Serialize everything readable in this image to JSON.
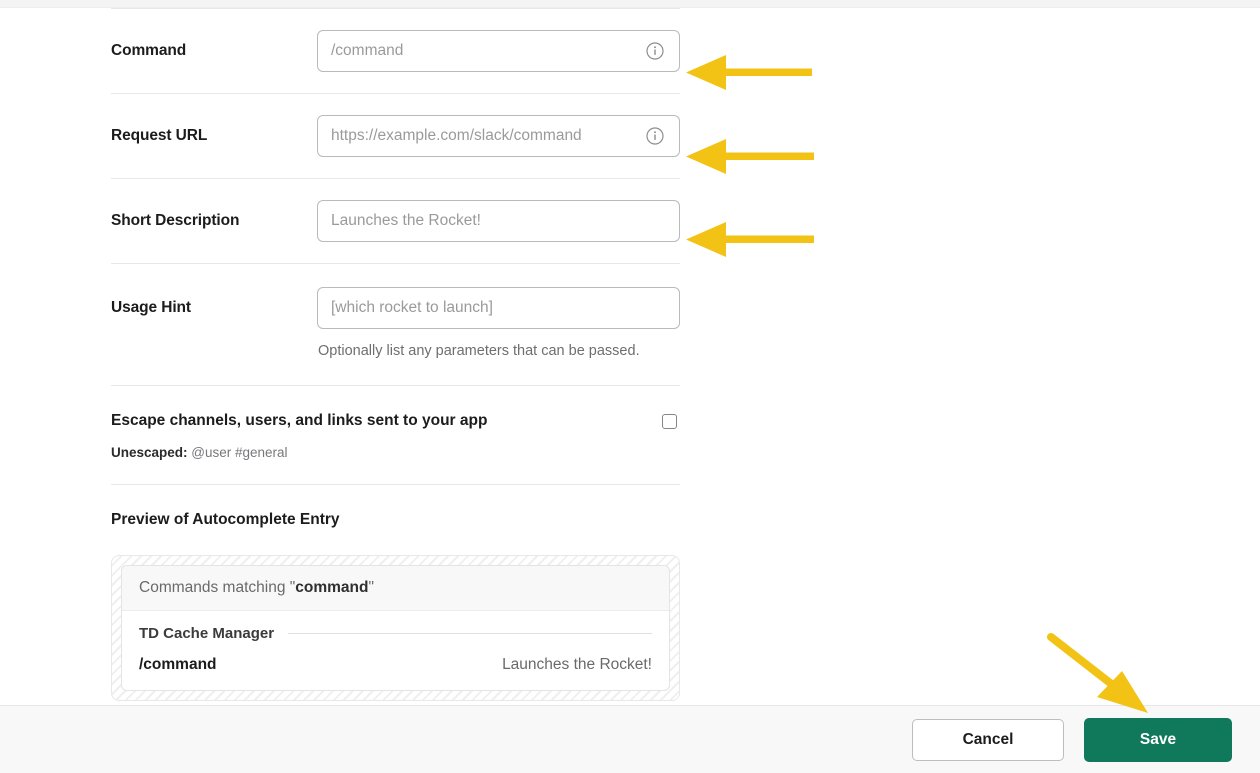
{
  "form": {
    "fields": [
      {
        "label": "Command",
        "placeholder": "/command",
        "value": "",
        "has_info_icon": true
      },
      {
        "label": "Request URL",
        "placeholder": "https://example.com/slack/command",
        "value": "",
        "has_info_icon": true
      },
      {
        "label": "Short Description",
        "placeholder": "Launches the Rocket!",
        "value": "",
        "has_info_icon": false
      },
      {
        "label": "Usage Hint",
        "placeholder": "[which rocket to launch]",
        "value": "",
        "has_info_icon": false,
        "helper": "Optionally list any parameters that can be passed."
      }
    ],
    "escape": {
      "title": "Escape channels, users, and links sent to your app",
      "checked": false,
      "unescaped_label": "Unescaped:",
      "unescaped_value": "@user #general"
    },
    "preview": {
      "section_title": "Preview of Autocomplete Entry",
      "header_prefix": "Commands matching \"",
      "header_term": "command",
      "header_suffix": "\"",
      "group_name": "TD Cache Manager",
      "items": [
        {
          "command": "/command",
          "description": "Launches the Rocket!"
        }
      ]
    }
  },
  "action_bar": {
    "cancel_label": "Cancel",
    "save_label": "Save"
  },
  "colors": {
    "save_green": "#11795b",
    "arrow_yellow": "#f2c314",
    "text_primary": "#1d1c1d",
    "placeholder": "#9a9a9a"
  },
  "annotations": {
    "arrows": [
      {
        "name": "arrow-to-command-field",
        "direction": "left"
      },
      {
        "name": "arrow-to-request-url-field",
        "direction": "left"
      },
      {
        "name": "arrow-to-short-description-field",
        "direction": "left"
      },
      {
        "name": "arrow-to-save-button",
        "direction": "down-right"
      }
    ]
  }
}
